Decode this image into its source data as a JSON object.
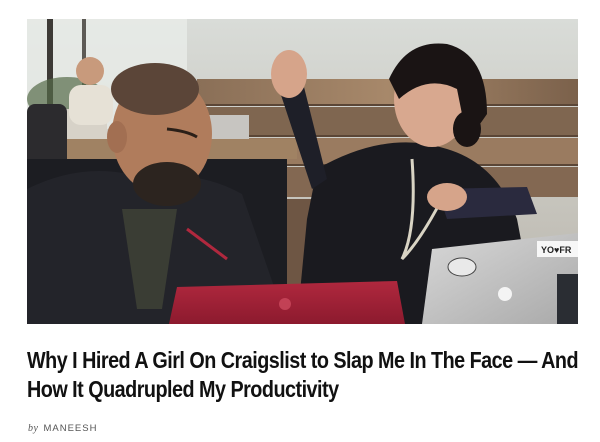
{
  "article": {
    "image_alt": "",
    "title_line1": "Why I Hired A Girl On Craigslist to Slap Me In The Face — And",
    "title_line2": "How It Quadrupled My Productivity",
    "byline_prefix": "by",
    "author": "MANEESH",
    "laptop_sticker": "YO♥FR"
  }
}
